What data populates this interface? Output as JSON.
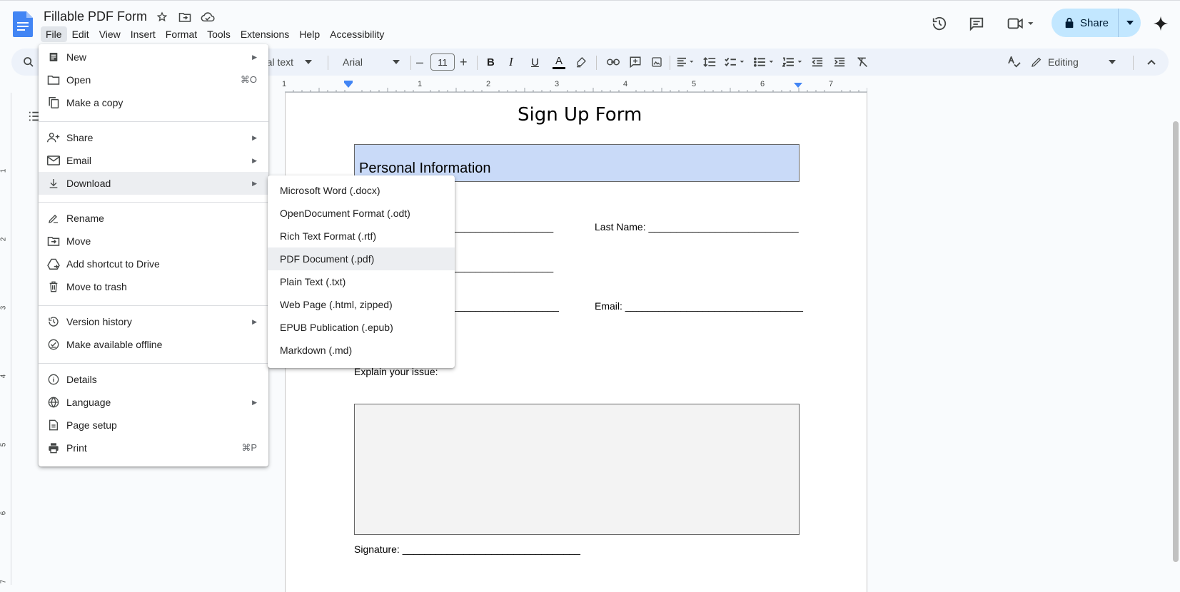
{
  "doc": {
    "title": "Fillable PDF Form"
  },
  "menubar": [
    "File",
    "Edit",
    "View",
    "Insert",
    "Format",
    "Tools",
    "Extensions",
    "Help",
    "Accessibility"
  ],
  "header": {
    "share_label": "Share"
  },
  "toolbar": {
    "style_label": "mal text",
    "font_label": "Arial",
    "font_size": "11",
    "editing_label": "Editing"
  },
  "ruler": {
    "h_ticks": [
      "1",
      "1",
      "2",
      "3",
      "4",
      "5",
      "6",
      "7"
    ],
    "v_ticks": [
      "1",
      "2",
      "3",
      "4",
      "5",
      "6",
      "7"
    ]
  },
  "file_menu": [
    {
      "label": "New",
      "icon": "document-icon",
      "submenu": true
    },
    {
      "label": "Open",
      "icon": "folder-icon",
      "shortcut": "⌘O"
    },
    {
      "label": "Make a copy",
      "icon": "copy-icon"
    },
    {
      "label": "Share",
      "icon": "person-add-icon",
      "submenu": true
    },
    {
      "label": "Email",
      "icon": "mail-icon",
      "submenu": true
    },
    {
      "label": "Download",
      "icon": "download-icon",
      "submenu": true
    },
    {
      "label": "Rename",
      "icon": "rename-icon"
    },
    {
      "label": "Move",
      "icon": "move-folder-icon"
    },
    {
      "label": "Add shortcut to Drive",
      "icon": "drive-shortcut-icon"
    },
    {
      "label": "Move to trash",
      "icon": "trash-icon"
    },
    {
      "label": "Version history",
      "icon": "history-icon",
      "submenu": true
    },
    {
      "label": "Make available offline",
      "icon": "offline-icon"
    },
    {
      "label": "Details",
      "icon": "info-icon"
    },
    {
      "label": "Language",
      "icon": "globe-icon",
      "submenu": true
    },
    {
      "label": "Page setup",
      "icon": "page-setup-icon"
    },
    {
      "label": "Print",
      "icon": "print-icon",
      "shortcut": "⌘P"
    }
  ],
  "download_menu": [
    "Microsoft Word (.docx)",
    "OpenDocument Format (.odt)",
    "Rich Text Format (.rtf)",
    "PDF Document (.pdf)",
    "Plain Text (.txt)",
    "Web Page (.html, zipped)",
    "EPUB Publication (.epub)",
    "Markdown (.md)"
  ],
  "form": {
    "title": "Sign Up Form",
    "section": "Personal Information",
    "last_name": "Last Name: ___________________________",
    "first_name_tail": "__________________",
    "row2_tail": "__________________",
    "row3_tail": "___________________",
    "email": "Email: ________________________________",
    "issue_label": "Explain your issue:",
    "signature": "Signature: ________________________________"
  }
}
